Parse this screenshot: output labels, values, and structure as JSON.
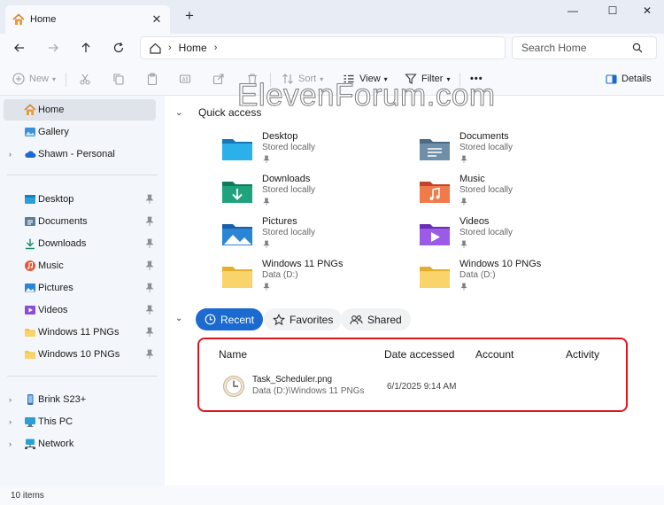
{
  "window": {
    "tab_title": "Home",
    "minimize": "—",
    "maximize": "☐",
    "close": "✕",
    "new_tab": "+"
  },
  "address": {
    "crumb": "Home",
    "search_placeholder": "Search Home"
  },
  "commands": {
    "new": "New",
    "sort": "Sort",
    "view": "View",
    "filter": "Filter",
    "more": "•••",
    "details": "Details"
  },
  "sidebar": {
    "items": [
      {
        "label": "Home"
      },
      {
        "label": "Gallery"
      },
      {
        "label": "Shawn - Personal"
      },
      {
        "label": "Desktop"
      },
      {
        "label": "Documents"
      },
      {
        "label": "Downloads"
      },
      {
        "label": "Music"
      },
      {
        "label": "Pictures"
      },
      {
        "label": "Videos"
      },
      {
        "label": "Windows 11 PNGs"
      },
      {
        "label": "Windows 10 PNGs"
      },
      {
        "label": "Brink S23+"
      },
      {
        "label": "This PC"
      },
      {
        "label": "Network"
      }
    ]
  },
  "quick_access": {
    "title": "Quick access",
    "items": [
      {
        "name": "Desktop",
        "sub": "Stored locally"
      },
      {
        "name": "Documents",
        "sub": "Stored locally"
      },
      {
        "name": "Downloads",
        "sub": "Stored locally"
      },
      {
        "name": "Music",
        "sub": "Stored locally"
      },
      {
        "name": "Pictures",
        "sub": "Stored locally"
      },
      {
        "name": "Videos",
        "sub": "Stored locally"
      },
      {
        "name": "Windows 11 PNGs",
        "sub": "Data (D:)"
      },
      {
        "name": "Windows 10 PNGs",
        "sub": "Data (D:)"
      }
    ]
  },
  "recent_tabs": {
    "recent": "Recent",
    "favorites": "Favorites",
    "shared": "Shared"
  },
  "recent_table": {
    "headers": {
      "name": "Name",
      "date": "Date accessed",
      "account": "Account",
      "activity": "Activity"
    },
    "rows": [
      {
        "name": "Task_Scheduler.png",
        "path": "Data (D:)\\Windows 11 PNGs",
        "date": "6/1/2025 9:14 AM"
      }
    ]
  },
  "watermark": "ElevenForum.com",
  "status": {
    "count": "10 items"
  },
  "colors": {
    "accent": "#1a6ad0",
    "highlight_box": "#e0161f"
  }
}
